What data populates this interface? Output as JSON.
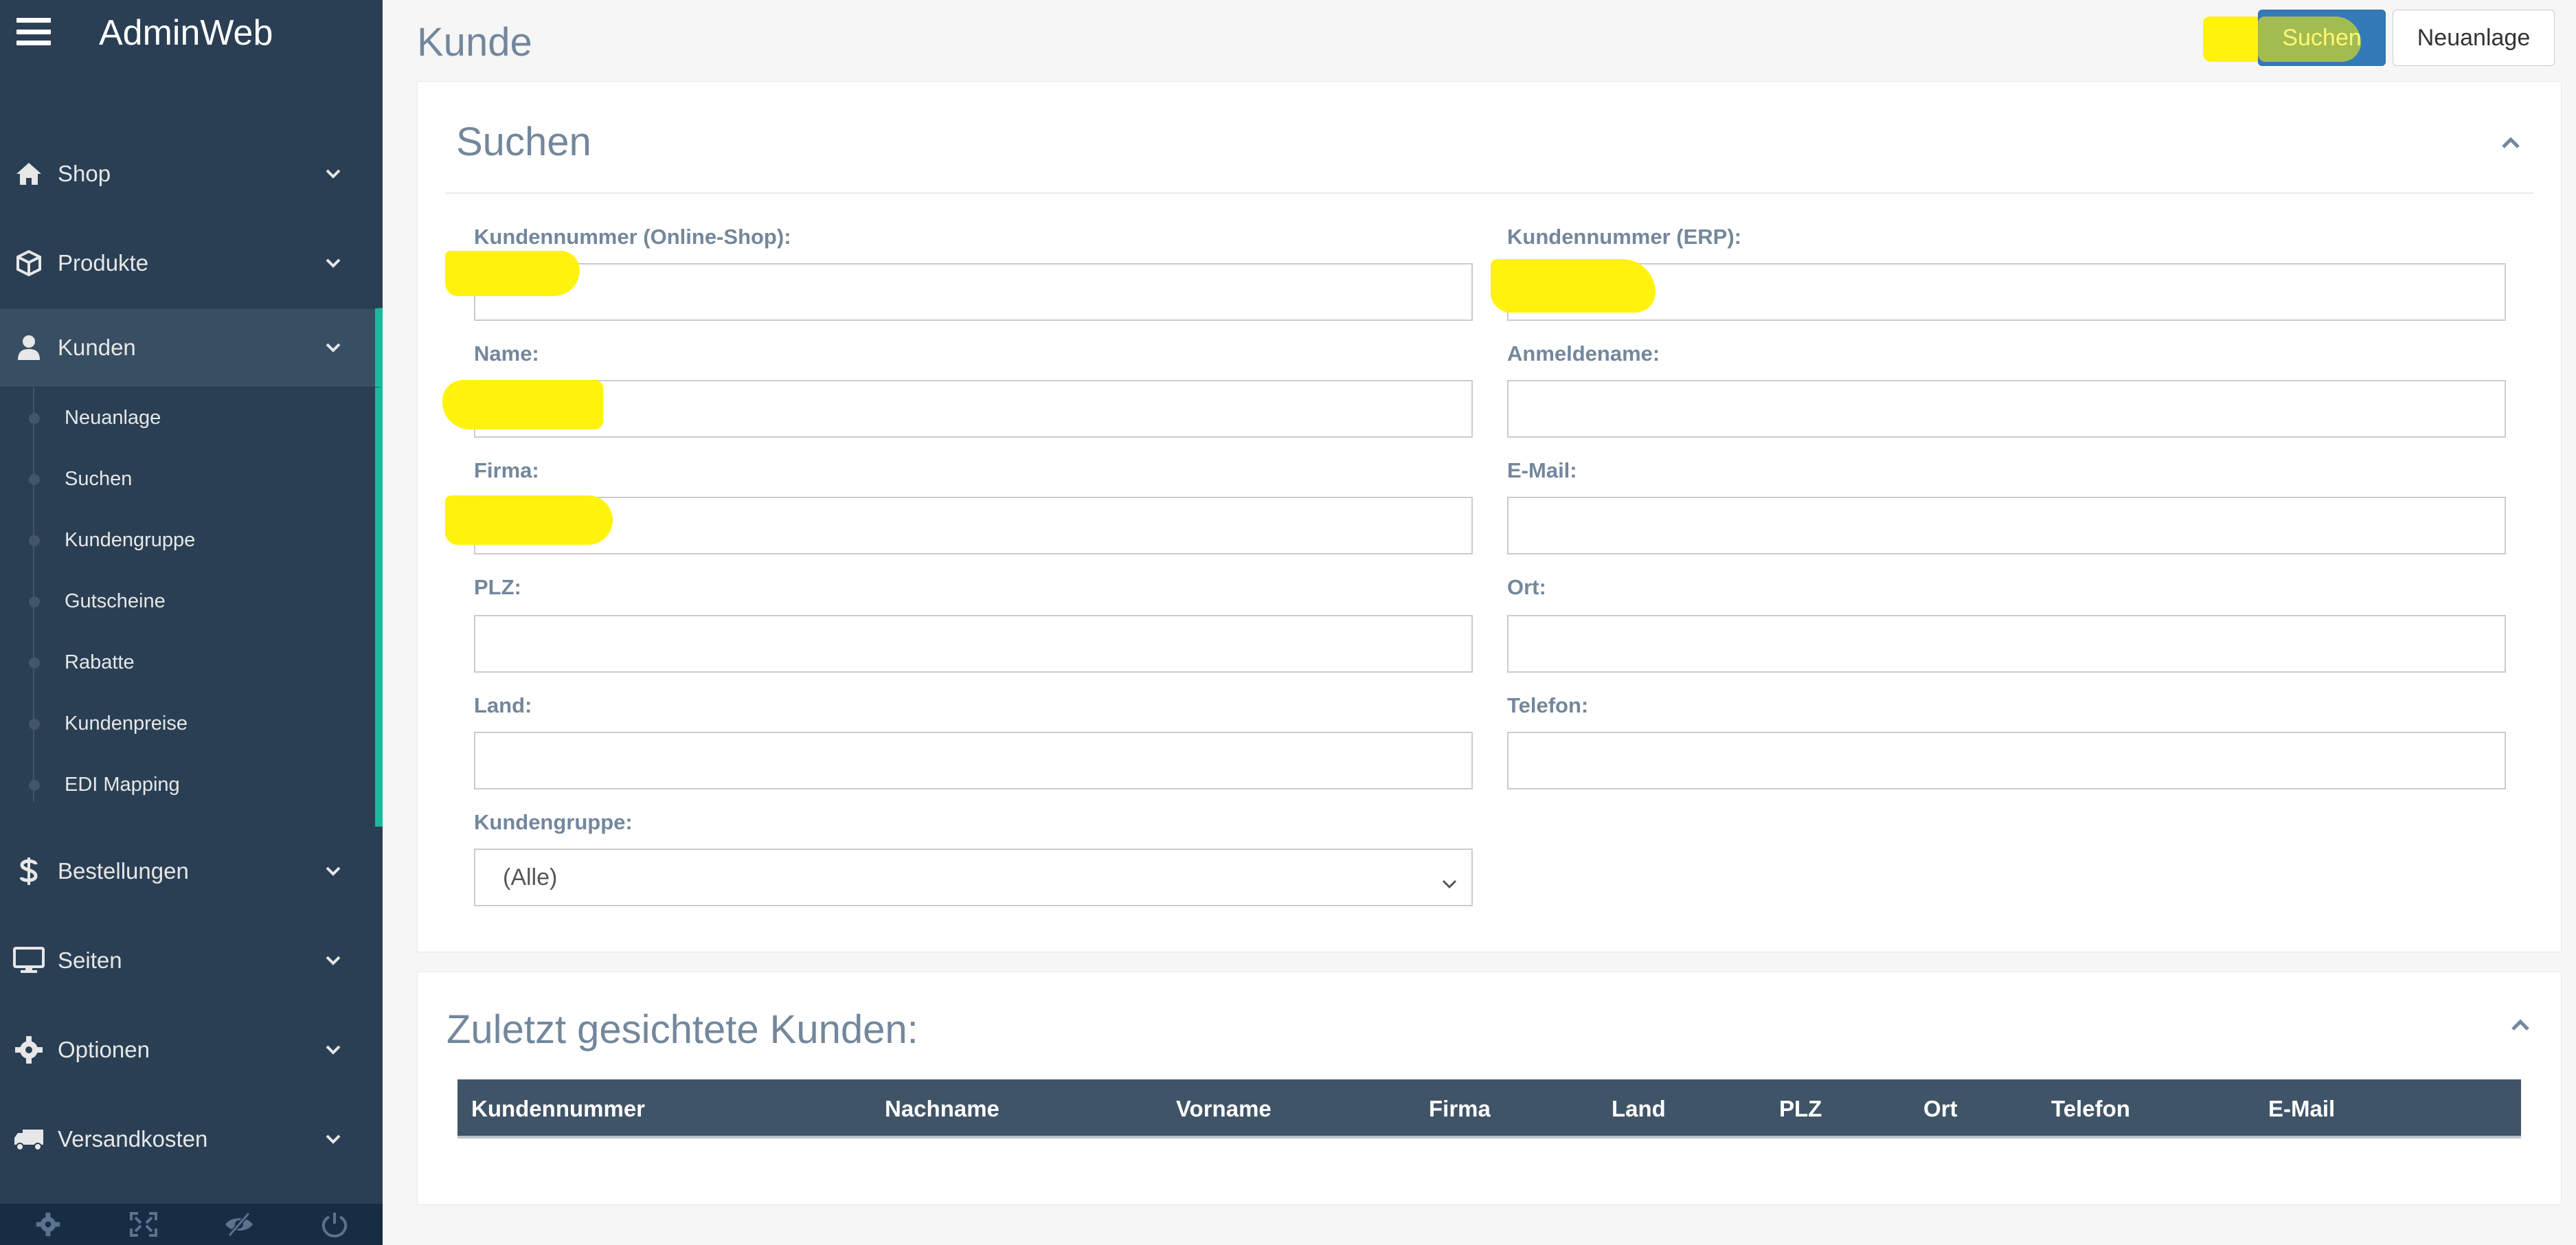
{
  "app": {
    "title": "AdminWeb"
  },
  "sidebar": {
    "items": [
      {
        "label": "Shop",
        "icon": "home-icon"
      },
      {
        "label": "Produkte",
        "icon": "cube-icon"
      },
      {
        "label": "Kunden",
        "icon": "user-icon",
        "active": true
      },
      {
        "label": "Bestellungen",
        "icon": "dollar-icon"
      },
      {
        "label": "Seiten",
        "icon": "desktop-icon"
      },
      {
        "label": "Optionen",
        "icon": "gear-icon"
      },
      {
        "label": "Versandkosten",
        "icon": "truck-icon"
      }
    ],
    "submenu": [
      {
        "label": "Neuanlage"
      },
      {
        "label": "Suchen"
      },
      {
        "label": "Kundengruppe"
      },
      {
        "label": "Gutscheine"
      },
      {
        "label": "Rabatte"
      },
      {
        "label": "Kundenpreise"
      },
      {
        "label": "EDI Mapping"
      }
    ],
    "footer": [
      "settings-icon",
      "fullscreen-icon",
      "eye-slash-icon",
      "power-icon"
    ]
  },
  "header": {
    "title": "Kunde",
    "search_button": "Suchen",
    "new_button": "Neuanlage"
  },
  "search_panel": {
    "title": "Suchen",
    "fields": {
      "customer_no_shop": {
        "label": "Kundennummer (Online-Shop):",
        "value": ""
      },
      "customer_no_erp": {
        "label": "Kundennummer (ERP):",
        "value": ""
      },
      "name": {
        "label": "Name:",
        "value": ""
      },
      "login_name": {
        "label": "Anmeldename:",
        "value": ""
      },
      "company": {
        "label": "Firma:",
        "value": ""
      },
      "email": {
        "label": "E-Mail:",
        "value": ""
      },
      "zip": {
        "label": "PLZ:",
        "value": ""
      },
      "city": {
        "label": "Ort:",
        "value": ""
      },
      "country": {
        "label": "Land:",
        "value": ""
      },
      "phone": {
        "label": "Telefon:",
        "value": ""
      },
      "customer_group": {
        "label": "Kundengruppe:",
        "value": "(Alle)"
      }
    }
  },
  "recent_panel": {
    "title": "Zuletzt gesichtete Kunden:",
    "columns": [
      "Kundennummer",
      "Nachname",
      "Vorname",
      "Firma",
      "Land",
      "PLZ",
      "Ort",
      "Telefon",
      "E-Mail"
    ]
  },
  "colors": {
    "sidebar_bg": "#2a3f54",
    "accent": "#1abb9c",
    "primary": "#337ab7",
    "table_header": "#405467",
    "highlight": "#fff200"
  }
}
